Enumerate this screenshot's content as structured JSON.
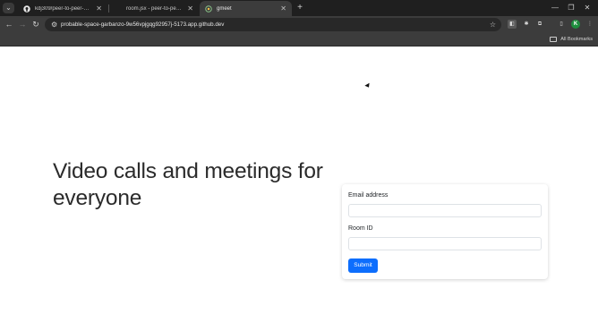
{
  "browser": {
    "tabs": [
      {
        "title": "kdj309/peer-to-peer-video-ch",
        "icon": "github-icon",
        "active": false
      },
      {
        "title": "room.jsx - peer-to-peer-video-",
        "icon": "vscode-icon",
        "active": false
      },
      {
        "title": "gmeet",
        "icon": "vite-icon",
        "active": true
      }
    ],
    "new_tab": "+",
    "url": "probable-space-garbanzo-9w56vpjgqg92957j-5173.app.github.dev",
    "avatar_letter": "K",
    "bookmarks_label": "All Bookmarks"
  },
  "page": {
    "hero_text": "Video calls and meetings for everyone",
    "form": {
      "email_label": "Email address",
      "email_value": "",
      "room_label": "Room ID",
      "room_value": "",
      "submit_label": "Submit"
    }
  },
  "colors": {
    "primary_button": "#0d6efd",
    "chrome_dark": "#1f1f1f",
    "toolbar": "#3c3c3c"
  }
}
